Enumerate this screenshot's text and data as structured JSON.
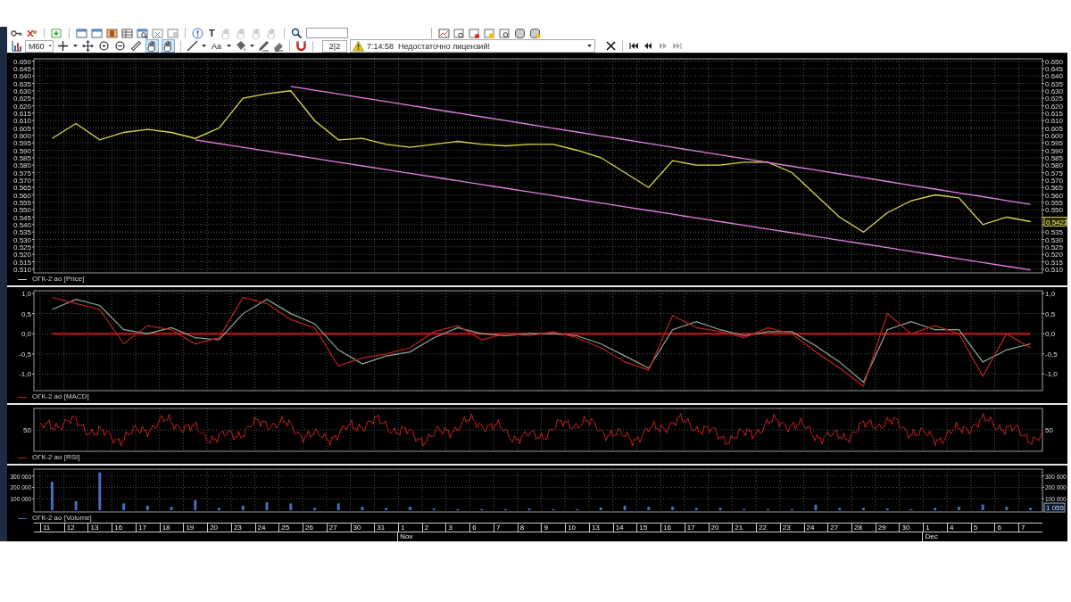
{
  "toolbar": {
    "annotation_tools": [
      {
        "disabled": false
      },
      {
        "disabled": true
      },
      {
        "disabled": true
      },
      {
        "disabled": true
      },
      {
        "disabled": true
      }
    ],
    "text_tool_label": "T",
    "timeframe": "M60",
    "draw_tools": [
      {
        "selected": false
      },
      {
        "selected": false
      },
      {
        "selected": false
      },
      {
        "selected": false
      },
      {
        "selected": false
      },
      {
        "selected": true
      },
      {
        "selected": true
      }
    ],
    "font_tool_label": "Aa",
    "page_indicator": "2|2",
    "message_time": "7:14:58",
    "message": "Недостаточно лицензий!",
    "nav_buttons": [
      {
        "disabled": false
      },
      {
        "disabled": false
      },
      {
        "disabled": true
      },
      {
        "disabled": true
      }
    ]
  },
  "price_panel": {
    "legend": {
      "label": "ОГК-2 ао [Price]",
      "color": "#d0d0d0"
    },
    "last_price_label": "0.5422",
    "chart_data": {
      "type": "line",
      "ylim": [
        0.5075,
        0.6515
      ],
      "yticks": [
        {
          "value": 0.65,
          "label": "0.650"
        },
        {
          "value": 0.645,
          "label": "0.645"
        },
        {
          "value": 0.64,
          "label": "0.640"
        },
        {
          "value": 0.635,
          "label": "0.635"
        },
        {
          "value": 0.63,
          "label": "0.630"
        },
        {
          "value": 0.625,
          "label": "0.625"
        },
        {
          "value": 0.62,
          "label": "0.620"
        },
        {
          "value": 0.615,
          "label": "0.615"
        },
        {
          "value": 0.61,
          "label": "0.610"
        },
        {
          "value": 0.605,
          "label": "0.605"
        },
        {
          "value": 0.6,
          "label": "0.600"
        },
        {
          "value": 0.595,
          "label": "0.595"
        },
        {
          "value": 0.59,
          "label": "0.590"
        },
        {
          "value": 0.585,
          "label": "0.585"
        },
        {
          "value": 0.58,
          "label": "0.580"
        },
        {
          "value": 0.575,
          "label": "0.575"
        },
        {
          "value": 0.57,
          "label": "0.570"
        },
        {
          "value": 0.565,
          "label": "0.565"
        },
        {
          "value": 0.56,
          "label": "0.560"
        },
        {
          "value": 0.555,
          "label": "0.555"
        },
        {
          "value": 0.55,
          "label": "0.550"
        },
        {
          "value": 0.545,
          "label": "0.545"
        },
        {
          "value": 0.54,
          "label": "0.540"
        },
        {
          "value": 0.535,
          "label": "0.535"
        },
        {
          "value": 0.53,
          "label": "0.530"
        },
        {
          "value": 0.525,
          "label": "0.525"
        },
        {
          "value": 0.52,
          "label": "0.520"
        },
        {
          "value": 0.515,
          "label": "0.515"
        },
        {
          "value": 0.51,
          "label": "0.510"
        }
      ],
      "series": [
        {
          "color": "#d8d84a",
          "values": [
            0.598,
            0.608,
            0.597,
            0.602,
            0.604,
            0.602,
            0.598,
            0.605,
            0.625,
            0.628,
            0.63,
            0.61,
            0.597,
            0.598,
            0.594,
            0.592,
            0.594,
            0.596,
            0.594,
            0.593,
            0.594,
            0.594,
            0.59,
            0.585,
            0.575,
            0.565,
            0.583,
            0.58,
            0.58,
            0.582,
            0.582,
            0.575,
            0.56,
            0.545,
            0.535,
            0.548,
            0.556,
            0.56,
            0.558,
            0.54,
            0.545,
            0.542
          ]
        },
        {
          "color": "#e27fe2",
          "values": [
            null,
            null,
            null,
            null,
            null,
            null,
            null,
            null,
            null,
            null,
            0.633,
            0.6304,
            0.6279,
            0.6253,
            0.6228,
            0.6202,
            0.6176,
            0.6151,
            0.6125,
            0.61,
            0.6074,
            0.6048,
            0.6023,
            0.5997,
            0.5972,
            0.5946,
            0.592,
            0.5895,
            0.5869,
            0.5844,
            0.5818,
            0.5792,
            0.5767,
            0.5741,
            0.5716,
            0.569,
            0.5664,
            0.5639,
            0.5613,
            0.5588,
            0.5562,
            0.5536
          ]
        },
        {
          "color": "#e27fe2",
          "values": [
            null,
            null,
            null,
            null,
            null,
            null,
            0.597,
            0.5945,
            0.592,
            0.5895,
            0.587,
            0.5845,
            0.582,
            0.5795,
            0.577,
            0.5745,
            0.572,
            0.5695,
            0.567,
            0.5645,
            0.562,
            0.5595,
            0.557,
            0.5545,
            0.552,
            0.5495,
            0.547,
            0.5445,
            0.542,
            0.5395,
            0.537,
            0.5345,
            0.532,
            0.5295,
            0.527,
            0.5245,
            0.522,
            0.5195,
            0.517,
            0.5145,
            0.512,
            0.5095
          ]
        }
      ],
      "grid": true
    }
  },
  "macd_panel": {
    "legend": {
      "label": "ОГК-2 ао [MACD]",
      "color": "#c02020"
    },
    "chart_data": {
      "type": "line",
      "ylim": [
        -1.41,
        1.065
      ],
      "yticks": [
        {
          "value": 1,
          "label": "1,0"
        },
        {
          "value": 0.5,
          "label": "0,5"
        },
        {
          "value": 0,
          "label": "0,0"
        },
        {
          "value": -0.5,
          "label": "-0,5"
        },
        {
          "value": -1,
          "label": "-1,0"
        }
      ],
      "series": [
        {
          "color": "#c81818",
          "values": [
            0,
            0,
            0,
            0,
            0,
            0,
            0,
            0,
            0,
            0,
            0,
            0,
            0,
            0,
            0,
            0,
            0,
            0,
            0,
            0,
            0,
            0,
            0,
            0,
            0,
            0,
            0,
            0,
            0,
            0,
            0,
            0,
            0,
            0,
            0,
            0,
            0,
            0,
            0,
            0,
            0,
            0
          ]
        },
        {
          "color": "#8fa89a",
          "values": [
            0.6,
            0.85,
            0.7,
            0.1,
            0.0,
            0.15,
            -0.1,
            -0.15,
            0.5,
            0.85,
            0.5,
            0.25,
            -0.4,
            -0.75,
            -0.55,
            -0.45,
            -0.1,
            0.15,
            0.0,
            -0.05,
            0.0,
            0.0,
            -0.05,
            -0.25,
            -0.55,
            -0.85,
            0.1,
            0.3,
            0.1,
            -0.05,
            0.05,
            0.05,
            -0.3,
            -0.7,
            -1.2,
            0.1,
            0.3,
            0.1,
            0.1,
            -0.7,
            -0.4,
            -0.25
          ]
        },
        {
          "color": "#c02020",
          "values": [
            0.9,
            0.75,
            0.6,
            -0.25,
            0.2,
            0.1,
            -0.25,
            -0.1,
            0.9,
            0.75,
            0.35,
            0.15,
            -0.8,
            -0.6,
            -0.5,
            -0.35,
            0.05,
            0.2,
            -0.15,
            0.0,
            -0.05,
            0.05,
            -0.1,
            -0.35,
            -0.7,
            -0.9,
            0.45,
            0.15,
            0.05,
            -0.1,
            0.15,
            0.0,
            -0.45,
            -0.85,
            -1.3,
            0.5,
            0.0,
            0.2,
            0.0,
            -1.05,
            0.0,
            -0.35
          ]
        }
      ],
      "grid": true
    }
  },
  "rsi_panel": {
    "legend": {
      "label": "ОГК-2 ао [RSI]",
      "color": "#c02020"
    },
    "left_axis_label": "50",
    "right_axis_label": "50"
  },
  "volume_panel": {
    "legend": {
      "label": "ОГК-2 ао [Volume]",
      "color": "#3f6fbf"
    },
    "last_volume_label": "1 055",
    "chart_data": {
      "type": "bar",
      "ylim": [
        -15000,
        360000
      ],
      "yticks": [
        {
          "value": 300000,
          "label": "300 000"
        },
        {
          "value": 200000,
          "label": "200 000"
        },
        {
          "value": 100000,
          "label": "100 000"
        }
      ],
      "series": [
        {
          "color": "#3f6fbf",
          "values": [
            250000,
            80000,
            330000,
            60000,
            40000,
            30000,
            90000,
            20000,
            40000,
            70000,
            60000,
            20000,
            60000,
            30000,
            20000,
            30000,
            15000,
            10000,
            10000,
            10000,
            15000,
            10000,
            10000,
            25000,
            40000,
            30000,
            30000,
            20000,
            20000,
            10000,
            10000,
            10000,
            50000,
            20000,
            20000,
            15000,
            10000,
            20000,
            30000,
            50000,
            30000,
            20000
          ]
        }
      ],
      "grid": true
    }
  },
  "date_axis": [
    {
      "day": "11"
    },
    {
      "day": "12"
    },
    {
      "day": "13"
    },
    {
      "day": "16"
    },
    {
      "day": "17"
    },
    {
      "day": "18"
    },
    {
      "day": "19"
    },
    {
      "day": "20"
    },
    {
      "day": "23"
    },
    {
      "day": "24"
    },
    {
      "day": "25"
    },
    {
      "day": "26"
    },
    {
      "day": "27"
    },
    {
      "day": "30"
    },
    {
      "day": "31"
    },
    {
      "day": "1",
      "month": "Nov"
    },
    {
      "day": "2"
    },
    {
      "day": "3"
    },
    {
      "day": "6"
    },
    {
      "day": "7"
    },
    {
      "day": "8"
    },
    {
      "day": "9"
    },
    {
      "day": "10"
    },
    {
      "day": "13"
    },
    {
      "day": "14"
    },
    {
      "day": "15"
    },
    {
      "day": "16"
    },
    {
      "day": "17"
    },
    {
      "day": "20"
    },
    {
      "day": "21"
    },
    {
      "day": "22"
    },
    {
      "day": "23"
    },
    {
      "day": "24"
    },
    {
      "day": "27"
    },
    {
      "day": "28"
    },
    {
      "day": "29"
    },
    {
      "day": "30"
    },
    {
      "day": "1",
      "month": "Dec"
    },
    {
      "day": "4"
    },
    {
      "day": "5"
    },
    {
      "day": "6"
    },
    {
      "day": "7"
    }
  ]
}
